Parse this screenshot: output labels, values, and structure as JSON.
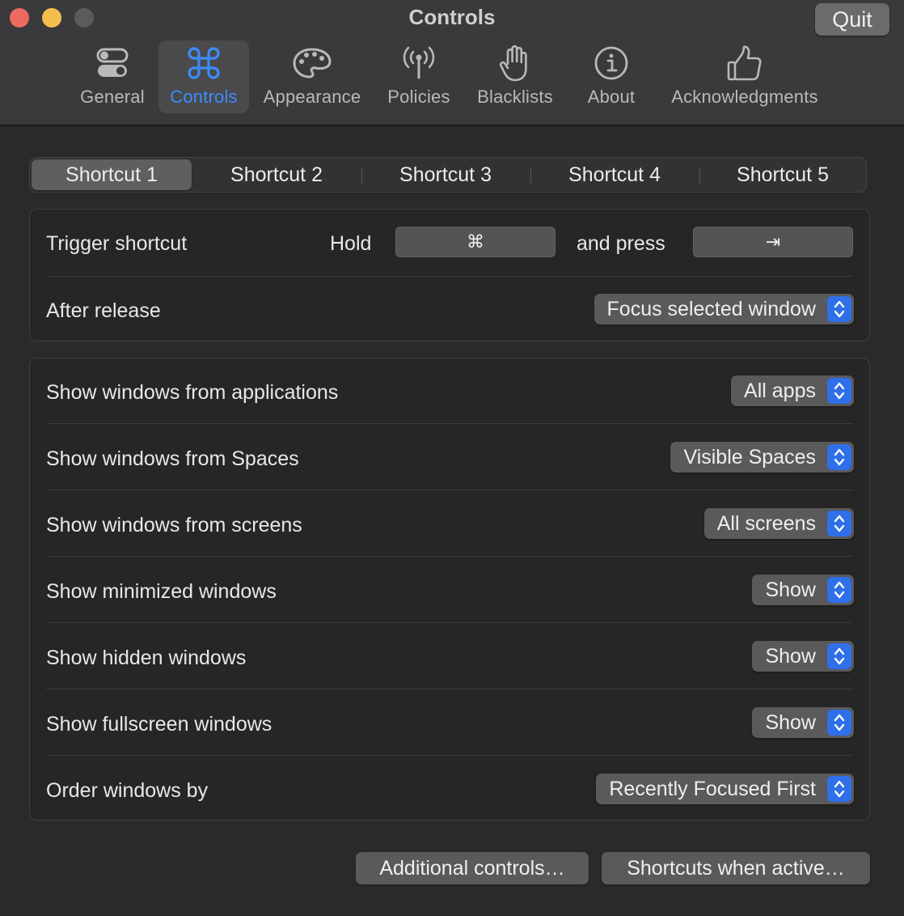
{
  "window": {
    "title": "Controls",
    "quit_label": "Quit"
  },
  "tabs": [
    {
      "label": "General",
      "icon": "toggles-icon"
    },
    {
      "label": "Controls",
      "icon": "command-icon",
      "selected": true
    },
    {
      "label": "Appearance",
      "icon": "palette-icon"
    },
    {
      "label": "Policies",
      "icon": "antenna-icon"
    },
    {
      "label": "Blacklists",
      "icon": "hand-icon"
    },
    {
      "label": "About",
      "icon": "info-icon"
    },
    {
      "label": "Acknowledgments",
      "icon": "thumbs-up-icon"
    }
  ],
  "shortcuts": [
    "Shortcut 1",
    "Shortcut 2",
    "Shortcut 3",
    "Shortcut 4",
    "Shortcut 5"
  ],
  "selected_shortcut": "Shortcut 1",
  "trigger": {
    "label": "Trigger shortcut",
    "hold_label": "Hold",
    "hold_key": "⌘",
    "press_label": "and press",
    "press_key": "⇥"
  },
  "after_release": {
    "label": "After release",
    "value": "Focus selected window"
  },
  "settings": [
    {
      "label": "Show windows from applications",
      "value": "All apps"
    },
    {
      "label": "Show windows from Spaces",
      "value": "Visible Spaces"
    },
    {
      "label": "Show windows from screens",
      "value": "All screens"
    },
    {
      "label": "Show minimized windows",
      "value": "Show"
    },
    {
      "label": "Show hidden windows",
      "value": "Show"
    },
    {
      "label": "Show fullscreen windows",
      "value": "Show"
    },
    {
      "label": "Order windows by",
      "value": "Recently Focused First"
    }
  ],
  "buttons": {
    "additional_controls": "Additional controls…",
    "shortcuts_when_active": "Shortcuts when active…"
  },
  "colors": {
    "accent": "#3b8cff",
    "popup_arrow": "#2f6fea",
    "background": "#2a2a2a",
    "toolbar": "#3a3a3c"
  }
}
